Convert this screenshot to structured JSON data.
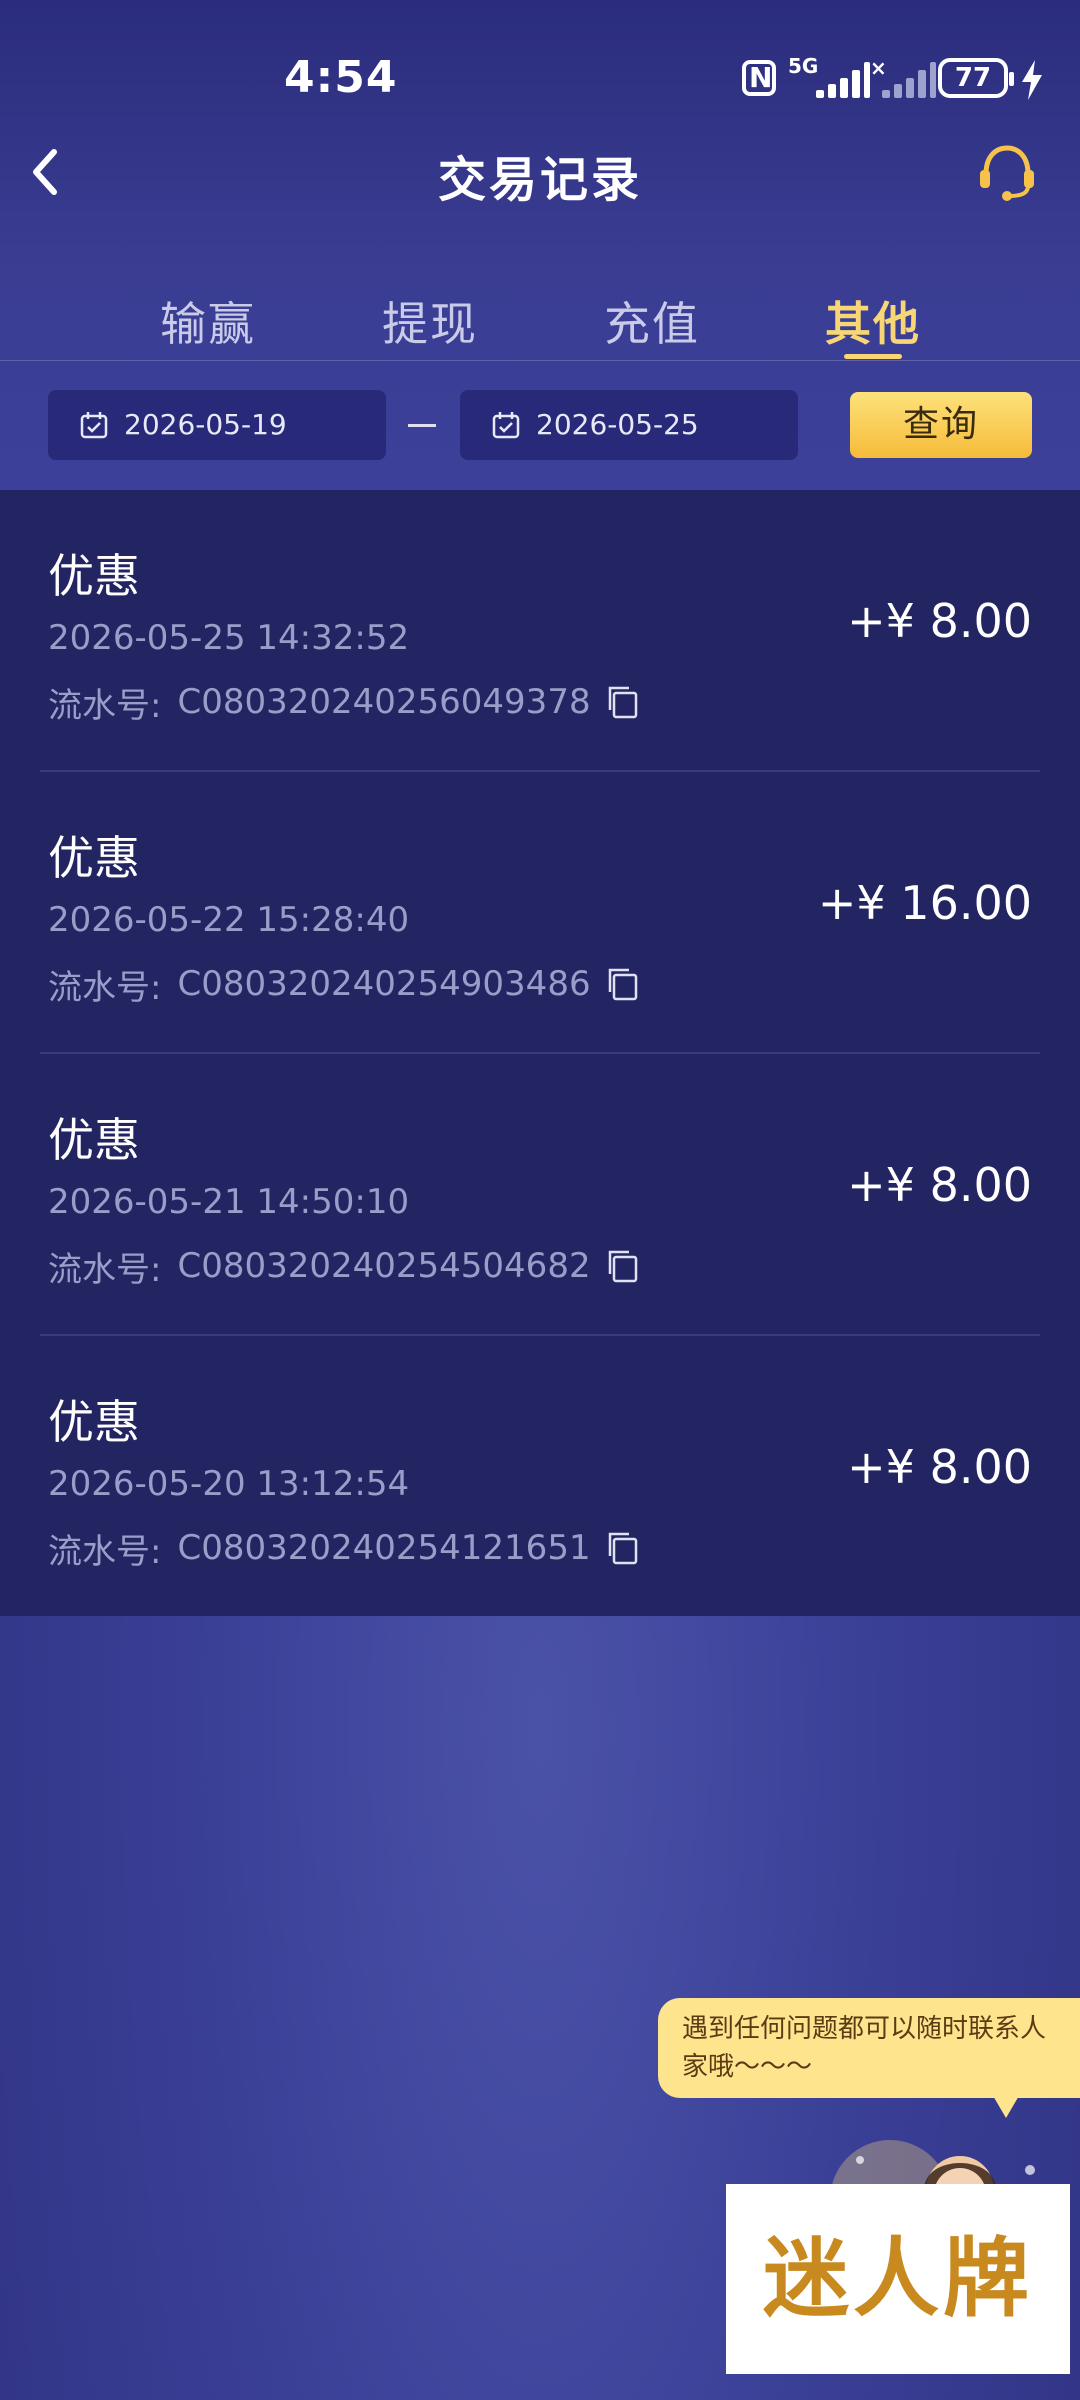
{
  "status_bar": {
    "time": "4:54",
    "network": "5G",
    "battery": "77"
  },
  "header": {
    "title": "交易记录"
  },
  "tabs": [
    {
      "label": "输赢",
      "active": false
    },
    {
      "label": "提现",
      "active": false
    },
    {
      "label": "充值",
      "active": false
    },
    {
      "label": "其他",
      "active": true
    }
  ],
  "filters": {
    "start_date": "2026-05-19",
    "end_date": "2026-05-25",
    "query_label": "查询"
  },
  "records": [
    {
      "type": "优惠",
      "time": "2026-05-25 14:32:52",
      "serial_label": "流水号:",
      "serial": "C080320240256049378",
      "amount": "+¥ 8.00"
    },
    {
      "type": "优惠",
      "time": "2026-05-22 15:28:40",
      "serial_label": "流水号:",
      "serial": "C080320240254903486",
      "amount": "+¥ 16.00"
    },
    {
      "type": "优惠",
      "time": "2026-05-21 14:50:10",
      "serial_label": "流水号:",
      "serial": "C080320240254504682",
      "amount": "+¥ 8.00"
    },
    {
      "type": "优惠",
      "time": "2026-05-20 13:12:54",
      "serial_label": "流水号:",
      "serial": "C080320240254121651",
      "amount": "+¥ 8.00"
    }
  ],
  "support_bubble": {
    "text": "遇到任何问题都可以随时联系人家哦～～～"
  },
  "watermark": {
    "text": "迷人牌"
  },
  "colors": {
    "accent": "#f8d676",
    "list_bg": "#232462",
    "muted_text": "#9b9dc9"
  }
}
